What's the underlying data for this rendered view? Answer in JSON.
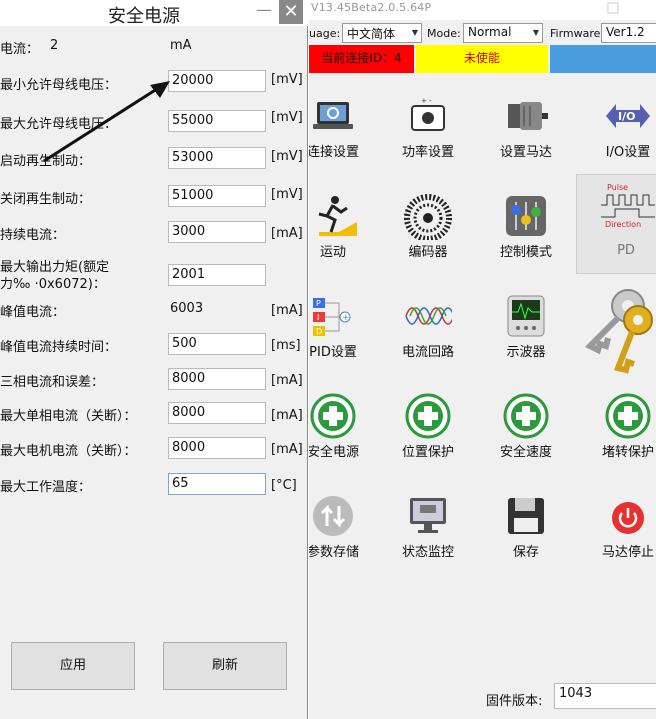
{
  "main": {
    "window_title": "V13.45Beta2.0.5.64P",
    "toolbar": {
      "language_label": "uage:",
      "language_value": "中文简体",
      "mode_label": "Mode:",
      "mode_value": "Normal",
      "firmware_label": "Firmware:",
      "firmware_value": "Ver1.2"
    },
    "status": {
      "connection_text": "当前连接ID：4",
      "enable_text": "未使能",
      "colors": {
        "connection_bg": "#ff0000",
        "enable_bg": "#ffff00",
        "right_bg": "#4a9ee0"
      }
    },
    "tiles": [
      {
        "label": "连接设置",
        "icon": "laptop-settings-icon"
      },
      {
        "label": "功率设置",
        "icon": "power-supply-icon"
      },
      {
        "label": "设置马达",
        "icon": "motor-icon"
      },
      {
        "label": "I/O设置",
        "icon": "io-arrows-icon"
      },
      {
        "label": "运动",
        "icon": "runner-icon"
      },
      {
        "label": "编码器",
        "icon": "encoder-disc-icon"
      },
      {
        "label": "控制模式",
        "icon": "control-sliders-icon"
      },
      {
        "label": "PD",
        "icon": "pulse-direction-icon",
        "pulse_text": "Pulse",
        "direction_text": "Direction"
      },
      {
        "label": "PID设置",
        "icon": "pid-diagram-icon"
      },
      {
        "label": "电流回路",
        "icon": "sine-waves-icon"
      },
      {
        "label": "示波器",
        "icon": "oscilloscope-icon"
      },
      {
        "label": "",
        "icon": "keys-icon"
      },
      {
        "label": "安全电源",
        "icon": "safety-cross-icon"
      },
      {
        "label": "位置保护",
        "icon": "safety-cross-icon"
      },
      {
        "label": "安全速度",
        "icon": "safety-cross-icon"
      },
      {
        "label": "堵转保护",
        "icon": "safety-cross-icon"
      },
      {
        "label": "参数存储",
        "icon": "save-arrows-icon"
      },
      {
        "label": "状态监控",
        "icon": "monitor-icon"
      },
      {
        "label": "保存",
        "icon": "floppy-disk-icon"
      },
      {
        "label": "马达停止",
        "icon": "power-stop-icon"
      }
    ],
    "firmware_version_label": "固件版本:",
    "firmware_version_value": "1043"
  },
  "dialog": {
    "title": "安全电源",
    "minimize_glyph": "—",
    "close_glyph": "✕",
    "rows": [
      {
        "label": "电流：",
        "value": "2",
        "unit": "mA",
        "editable": false
      },
      {
        "label": "最小允许母线电压：",
        "value": "20000",
        "unit": "[mV]",
        "editable": true
      },
      {
        "label": "最大允许母线电压：",
        "value": "55000",
        "unit": "[mV]",
        "editable": true
      },
      {
        "label": "启动再生制动：",
        "value": "53000",
        "unit": "[mV]",
        "editable": true
      },
      {
        "label": "关闭再生制动：",
        "value": "51000",
        "unit": "[mV]",
        "editable": true
      },
      {
        "label": "持续电流：",
        "value": "3000",
        "unit": "[mA]",
        "editable": true
      },
      {
        "label": "最大输出力矩(额定",
        "label2": "力‰ ·0x6072)：",
        "value": "2001",
        "unit": "",
        "editable": true
      },
      {
        "label": "峰值电流：",
        "value": "6003",
        "unit": "[mA]",
        "editable": false
      },
      {
        "label": "峰值电流持续时间：",
        "value": "500",
        "unit": "[ms]",
        "editable": true
      },
      {
        "label": "三相电流和误差：",
        "value": "8000",
        "unit": "[mA]",
        "editable": true
      },
      {
        "label": "最大单相电流（关断）：",
        "value": "8000",
        "unit": "[mA]",
        "editable": true
      },
      {
        "label": "最大电机电流（关断）：",
        "value": "8000",
        "unit": "[mA]",
        "editable": true
      },
      {
        "label": "最大工作温度：",
        "value": "65",
        "unit": "[°C]",
        "editable": true
      }
    ],
    "apply_label": "应用",
    "refresh_label": "刷新"
  }
}
